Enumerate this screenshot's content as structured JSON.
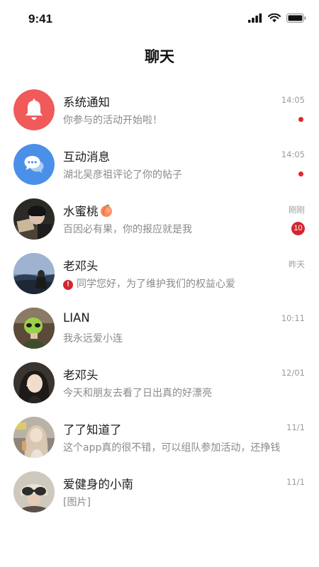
{
  "status_bar": {
    "time": "9:41",
    "icons": [
      "cellular-signal-icon",
      "wifi-icon",
      "battery-icon"
    ]
  },
  "header": {
    "title": "聊天"
  },
  "chats": [
    {
      "name": "系统通知",
      "preview": "你参与的活动开始啦！",
      "time": "14:05",
      "badge": "dot",
      "avatar": "bell-icon",
      "avatar_color": "#f05a5a"
    },
    {
      "name": "互动消息",
      "preview": "湖北吴彦祖评论了你的帖子",
      "time": "14:05",
      "badge": "dot",
      "avatar": "chat-bubble-icon",
      "avatar_color": "#4a90e8"
    },
    {
      "name": "水蜜桃",
      "name_emoji": "peach-icon",
      "preview": "百因必有果，你的报应就是我",
      "time": "刚刚",
      "badge_count": "10",
      "avatar": "user-photo"
    },
    {
      "name": "老邓头",
      "preview": "同学您好，为了维护我们的权益心爱",
      "preview_icon": "warning-icon",
      "time": "昨天",
      "avatar": "user-photo"
    },
    {
      "name": "LIAN",
      "preview": "我永远爱小连",
      "time": "10:11",
      "avatar": "user-photo"
    },
    {
      "name": "老邓头",
      "preview": "今天和朋友去看了日出真的好漂亮",
      "time": "12/01",
      "avatar": "user-photo"
    },
    {
      "name": "了了知道了",
      "preview": "这个app真的很不错，可以组队参加活动，还挣钱",
      "time": "11/1",
      "avatar": "user-photo"
    },
    {
      "name": "爱健身的小南",
      "preview": "[图片]",
      "time": "11/1",
      "avatar": "user-photo"
    }
  ],
  "colors": {
    "accent_red": "#e0282c",
    "badge_red": "#d32630",
    "notify_avatar": "#f05a5a",
    "message_avatar": "#4a90e8"
  }
}
